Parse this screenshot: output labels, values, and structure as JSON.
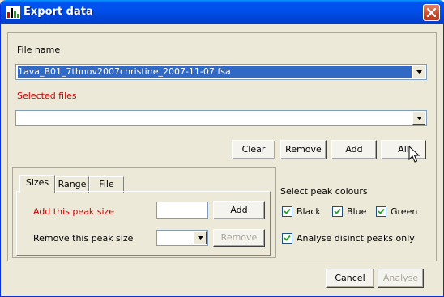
{
  "window": {
    "title": "Export data"
  },
  "file_name": {
    "label": "File name",
    "value": "1ava_B01_7thnov2007christine_2007-11-07.fsa"
  },
  "selected_files": {
    "label": "Selected files",
    "value": ""
  },
  "buttons": {
    "clear": "Clear",
    "remove": "Remove",
    "add": "Add",
    "all": "All"
  },
  "tabs": [
    {
      "label": "Sizes"
    },
    {
      "label": "Range"
    },
    {
      "label": "File"
    }
  ],
  "sizes_tab": {
    "add_label": "Add this peak size",
    "add_value": "",
    "add_button": "Add",
    "remove_label": "Remove this peak size",
    "remove_value": "",
    "remove_button": "Remove"
  },
  "peak_colours": {
    "title": "Select peak colours",
    "options": [
      {
        "label": "Black",
        "checked": true
      },
      {
        "label": "Blue",
        "checked": true
      },
      {
        "label": "Green",
        "checked": true
      }
    ],
    "distinct": {
      "label": "Analyse disinct peaks only",
      "checked": true
    }
  },
  "footer": {
    "cancel": "Cancel",
    "analyse": "Analyse"
  },
  "colors": {
    "title_bar": "#0053ee",
    "red_label": "#cc0000",
    "selection": "#316ac5",
    "dialog_bg": "#ece9d8"
  },
  "icons": {
    "app": "bar-chart-icon",
    "close": "close-icon",
    "dropdown": "chevron-down-icon",
    "cursor": "mouse-pointer-icon",
    "check": "checkmark-icon"
  }
}
